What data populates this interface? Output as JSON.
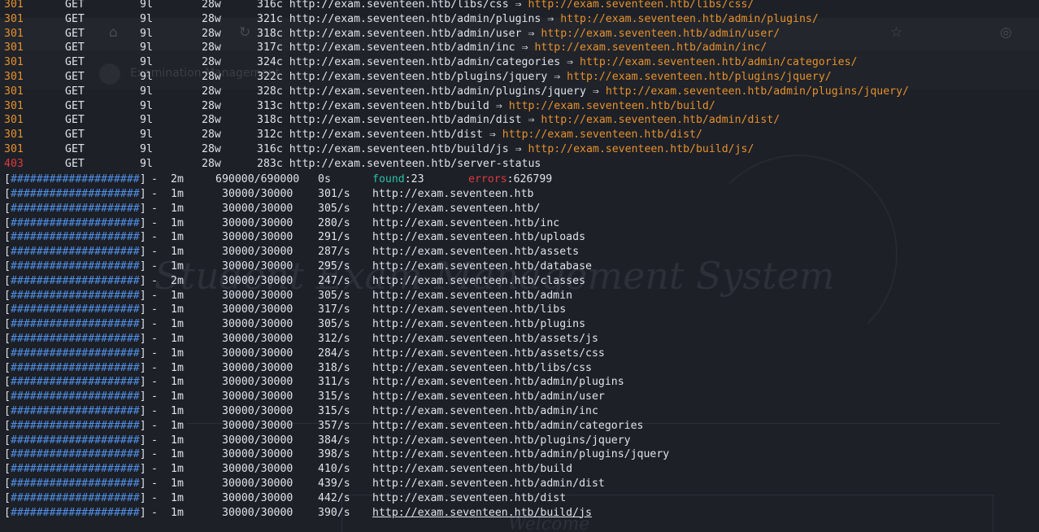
{
  "background": {
    "bookmark_text": "Examination Management",
    "hero_title": "Student Exam Management System",
    "welcome_text": "Welcome"
  },
  "colors": {
    "status_301": "#e6912d",
    "status_403": "#e0393e",
    "progress_fill": "#4f8fe6",
    "found": "#29c1a8",
    "errors": "#e0393e",
    "text": "#dfe3ea",
    "terminal_bg": "#1d2027"
  },
  "results": [
    {
      "status": "301",
      "method": "GET",
      "lines": "9l",
      "words": "28w",
      "chars": "316c",
      "url": "http://exam.seventeen.htb/libs/css",
      "redirect": "http://exam.seventeen.htb/libs/css/"
    },
    {
      "status": "301",
      "method": "GET",
      "lines": "9l",
      "words": "28w",
      "chars": "321c",
      "url": "http://exam.seventeen.htb/admin/plugins",
      "redirect": "http://exam.seventeen.htb/admin/plugins/"
    },
    {
      "status": "301",
      "method": "GET",
      "lines": "9l",
      "words": "28w",
      "chars": "318c",
      "url": "http://exam.seventeen.htb/admin/user",
      "redirect": "http://exam.seventeen.htb/admin/user/"
    },
    {
      "status": "301",
      "method": "GET",
      "lines": "9l",
      "words": "28w",
      "chars": "317c",
      "url": "http://exam.seventeen.htb/admin/inc",
      "redirect": "http://exam.seventeen.htb/admin/inc/"
    },
    {
      "status": "301",
      "method": "GET",
      "lines": "9l",
      "words": "28w",
      "chars": "324c",
      "url": "http://exam.seventeen.htb/admin/categories",
      "redirect": "http://exam.seventeen.htb/admin/categories/"
    },
    {
      "status": "301",
      "method": "GET",
      "lines": "9l",
      "words": "28w",
      "chars": "322c",
      "url": "http://exam.seventeen.htb/plugins/jquery",
      "redirect": "http://exam.seventeen.htb/plugins/jquery/"
    },
    {
      "status": "301",
      "method": "GET",
      "lines": "9l",
      "words": "28w",
      "chars": "328c",
      "url": "http://exam.seventeen.htb/admin/plugins/jquery",
      "redirect": "http://exam.seventeen.htb/admin/plugins/jquery/"
    },
    {
      "status": "301",
      "method": "GET",
      "lines": "9l",
      "words": "28w",
      "chars": "313c",
      "url": "http://exam.seventeen.htb/build",
      "redirect": "http://exam.seventeen.htb/build/"
    },
    {
      "status": "301",
      "method": "GET",
      "lines": "9l",
      "words": "28w",
      "chars": "318c",
      "url": "http://exam.seventeen.htb/admin/dist",
      "redirect": "http://exam.seventeen.htb/admin/dist/"
    },
    {
      "status": "301",
      "method": "GET",
      "lines": "9l",
      "words": "28w",
      "chars": "312c",
      "url": "http://exam.seventeen.htb/dist",
      "redirect": "http://exam.seventeen.htb/dist/"
    },
    {
      "status": "301",
      "method": "GET",
      "lines": "9l",
      "words": "28w",
      "chars": "316c",
      "url": "http://exam.seventeen.htb/build/js",
      "redirect": "http://exam.seventeen.htb/build/js/"
    },
    {
      "status": "403",
      "method": "GET",
      "lines": "9l",
      "words": "28w",
      "chars": "283c",
      "url": "http://exam.seventeen.htb/server-status",
      "redirect": ""
    }
  ],
  "arrow": "⇒",
  "summary": {
    "bar": "####################",
    "time": "2m",
    "progress": "690000/690000",
    "eta": "0s",
    "found_label": "found",
    "found_value": ":23",
    "errors_label": "errors",
    "errors_value": ":626799"
  },
  "scans": [
    {
      "bar": "####################",
      "time": "1m",
      "progress": "30000/30000",
      "rate": "301/s",
      "url": "http://exam.seventeen.htb"
    },
    {
      "bar": "####################",
      "time": "1m",
      "progress": "30000/30000",
      "rate": "305/s",
      "url": "http://exam.seventeen.htb/"
    },
    {
      "bar": "####################",
      "time": "1m",
      "progress": "30000/30000",
      "rate": "280/s",
      "url": "http://exam.seventeen.htb/inc"
    },
    {
      "bar": "####################",
      "time": "1m",
      "progress": "30000/30000",
      "rate": "291/s",
      "url": "http://exam.seventeen.htb/uploads"
    },
    {
      "bar": "####################",
      "time": "1m",
      "progress": "30000/30000",
      "rate": "287/s",
      "url": "http://exam.seventeen.htb/assets"
    },
    {
      "bar": "####################",
      "time": "1m",
      "progress": "30000/30000",
      "rate": "295/s",
      "url": "http://exam.seventeen.htb/database"
    },
    {
      "bar": "####################",
      "time": "2m",
      "progress": "30000/30000",
      "rate": "247/s",
      "url": "http://exam.seventeen.htb/classes"
    },
    {
      "bar": "####################",
      "time": "1m",
      "progress": "30000/30000",
      "rate": "305/s",
      "url": "http://exam.seventeen.htb/admin"
    },
    {
      "bar": "####################",
      "time": "1m",
      "progress": "30000/30000",
      "rate": "317/s",
      "url": "http://exam.seventeen.htb/libs"
    },
    {
      "bar": "####################",
      "time": "1m",
      "progress": "30000/30000",
      "rate": "305/s",
      "url": "http://exam.seventeen.htb/plugins"
    },
    {
      "bar": "####################",
      "time": "1m",
      "progress": "30000/30000",
      "rate": "312/s",
      "url": "http://exam.seventeen.htb/assets/js"
    },
    {
      "bar": "####################",
      "time": "1m",
      "progress": "30000/30000",
      "rate": "284/s",
      "url": "http://exam.seventeen.htb/assets/css"
    },
    {
      "bar": "####################",
      "time": "1m",
      "progress": "30000/30000",
      "rate": "318/s",
      "url": "http://exam.seventeen.htb/libs/css"
    },
    {
      "bar": "####################",
      "time": "1m",
      "progress": "30000/30000",
      "rate": "311/s",
      "url": "http://exam.seventeen.htb/admin/plugins"
    },
    {
      "bar": "####################",
      "time": "1m",
      "progress": "30000/30000",
      "rate": "315/s",
      "url": "http://exam.seventeen.htb/admin/user"
    },
    {
      "bar": "####################",
      "time": "1m",
      "progress": "30000/30000",
      "rate": "315/s",
      "url": "http://exam.seventeen.htb/admin/inc"
    },
    {
      "bar": "####################",
      "time": "1m",
      "progress": "30000/30000",
      "rate": "357/s",
      "url": "http://exam.seventeen.htb/admin/categories"
    },
    {
      "bar": "####################",
      "time": "1m",
      "progress": "30000/30000",
      "rate": "384/s",
      "url": "http://exam.seventeen.htb/plugins/jquery"
    },
    {
      "bar": "####################",
      "time": "1m",
      "progress": "30000/30000",
      "rate": "398/s",
      "url": "http://exam.seventeen.htb/admin/plugins/jquery"
    },
    {
      "bar": "####################",
      "time": "1m",
      "progress": "30000/30000",
      "rate": "410/s",
      "url": "http://exam.seventeen.htb/build"
    },
    {
      "bar": "####################",
      "time": "1m",
      "progress": "30000/30000",
      "rate": "439/s",
      "url": "http://exam.seventeen.htb/admin/dist"
    },
    {
      "bar": "####################",
      "time": "1m",
      "progress": "30000/30000",
      "rate": "442/s",
      "url": "http://exam.seventeen.htb/dist"
    },
    {
      "bar": "####################",
      "time": "1m",
      "progress": "30000/30000",
      "rate": "390/s",
      "url": "http://exam.seventeen.htb/build/js"
    }
  ]
}
